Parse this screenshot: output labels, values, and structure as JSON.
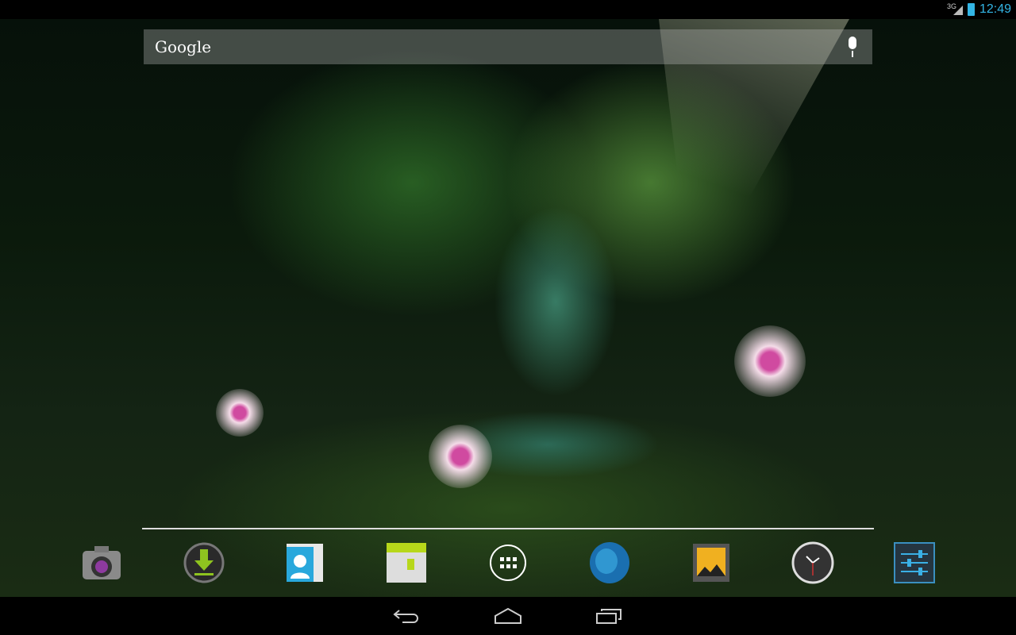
{
  "status_bar": {
    "network": "3G",
    "time": "12:49"
  },
  "search": {
    "label": "Google"
  },
  "dock": [
    {
      "app": "camera",
      "icon": "camera-icon"
    },
    {
      "app": "downloads",
      "icon": "download-icon"
    },
    {
      "app": "people",
      "icon": "contacts-icon"
    },
    {
      "app": "calendar",
      "icon": "calendar-icon"
    },
    {
      "app": "all-apps",
      "icon": "app-drawer-icon"
    },
    {
      "app": "browser",
      "icon": "globe-icon"
    },
    {
      "app": "gallery",
      "icon": "gallery-icon"
    },
    {
      "app": "clock",
      "icon": "clock-icon"
    },
    {
      "app": "settings",
      "icon": "settings-icon"
    }
  ],
  "nav": [
    "back-icon",
    "home-icon",
    "recents-icon"
  ],
  "colors": {
    "accent": "#33b5e5",
    "status_bar": "#000000"
  }
}
